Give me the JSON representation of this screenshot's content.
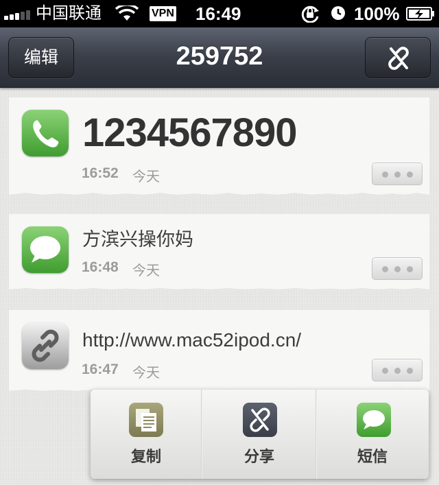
{
  "status_bar": {
    "carrier": "中国联通",
    "vpn_label": "VPN",
    "time": "16:49",
    "battery_percent": "100%",
    "signal_bars": 5,
    "signal_active_bars": 3,
    "icons": [
      "signal-icon",
      "wifi-icon",
      "vpn-badge",
      "rotation-lock-icon",
      "alarm-icon",
      "battery-charging-icon"
    ]
  },
  "nav": {
    "edit_label": "编辑",
    "title": "259752",
    "right_icon": "unlink-icon"
  },
  "clips": [
    {
      "type": "phone",
      "icon": "phone-icon",
      "text": "1234567890",
      "time": "16:52",
      "day": "今天"
    },
    {
      "type": "sms",
      "icon": "message-icon",
      "text": "方滨兴操你妈",
      "time": "16:48",
      "day": "今天"
    },
    {
      "type": "link",
      "icon": "link-icon",
      "text": "http://www.mac52ipod.cn/",
      "time": "16:47",
      "day": "今天"
    }
  ],
  "popup": {
    "actions": [
      {
        "label": "复制",
        "icon": "copy-icon"
      },
      {
        "label": "分享",
        "icon": "share-icon"
      },
      {
        "label": "短信",
        "icon": "sms-icon"
      }
    ]
  },
  "colors": {
    "nav_dark": "#2a2e36",
    "green_icon": "#4fae3c",
    "share_icon_bg": "#4a4f5c",
    "copy_icon_bg": "#8c8a60",
    "text_gray": "#9b9b9b"
  }
}
